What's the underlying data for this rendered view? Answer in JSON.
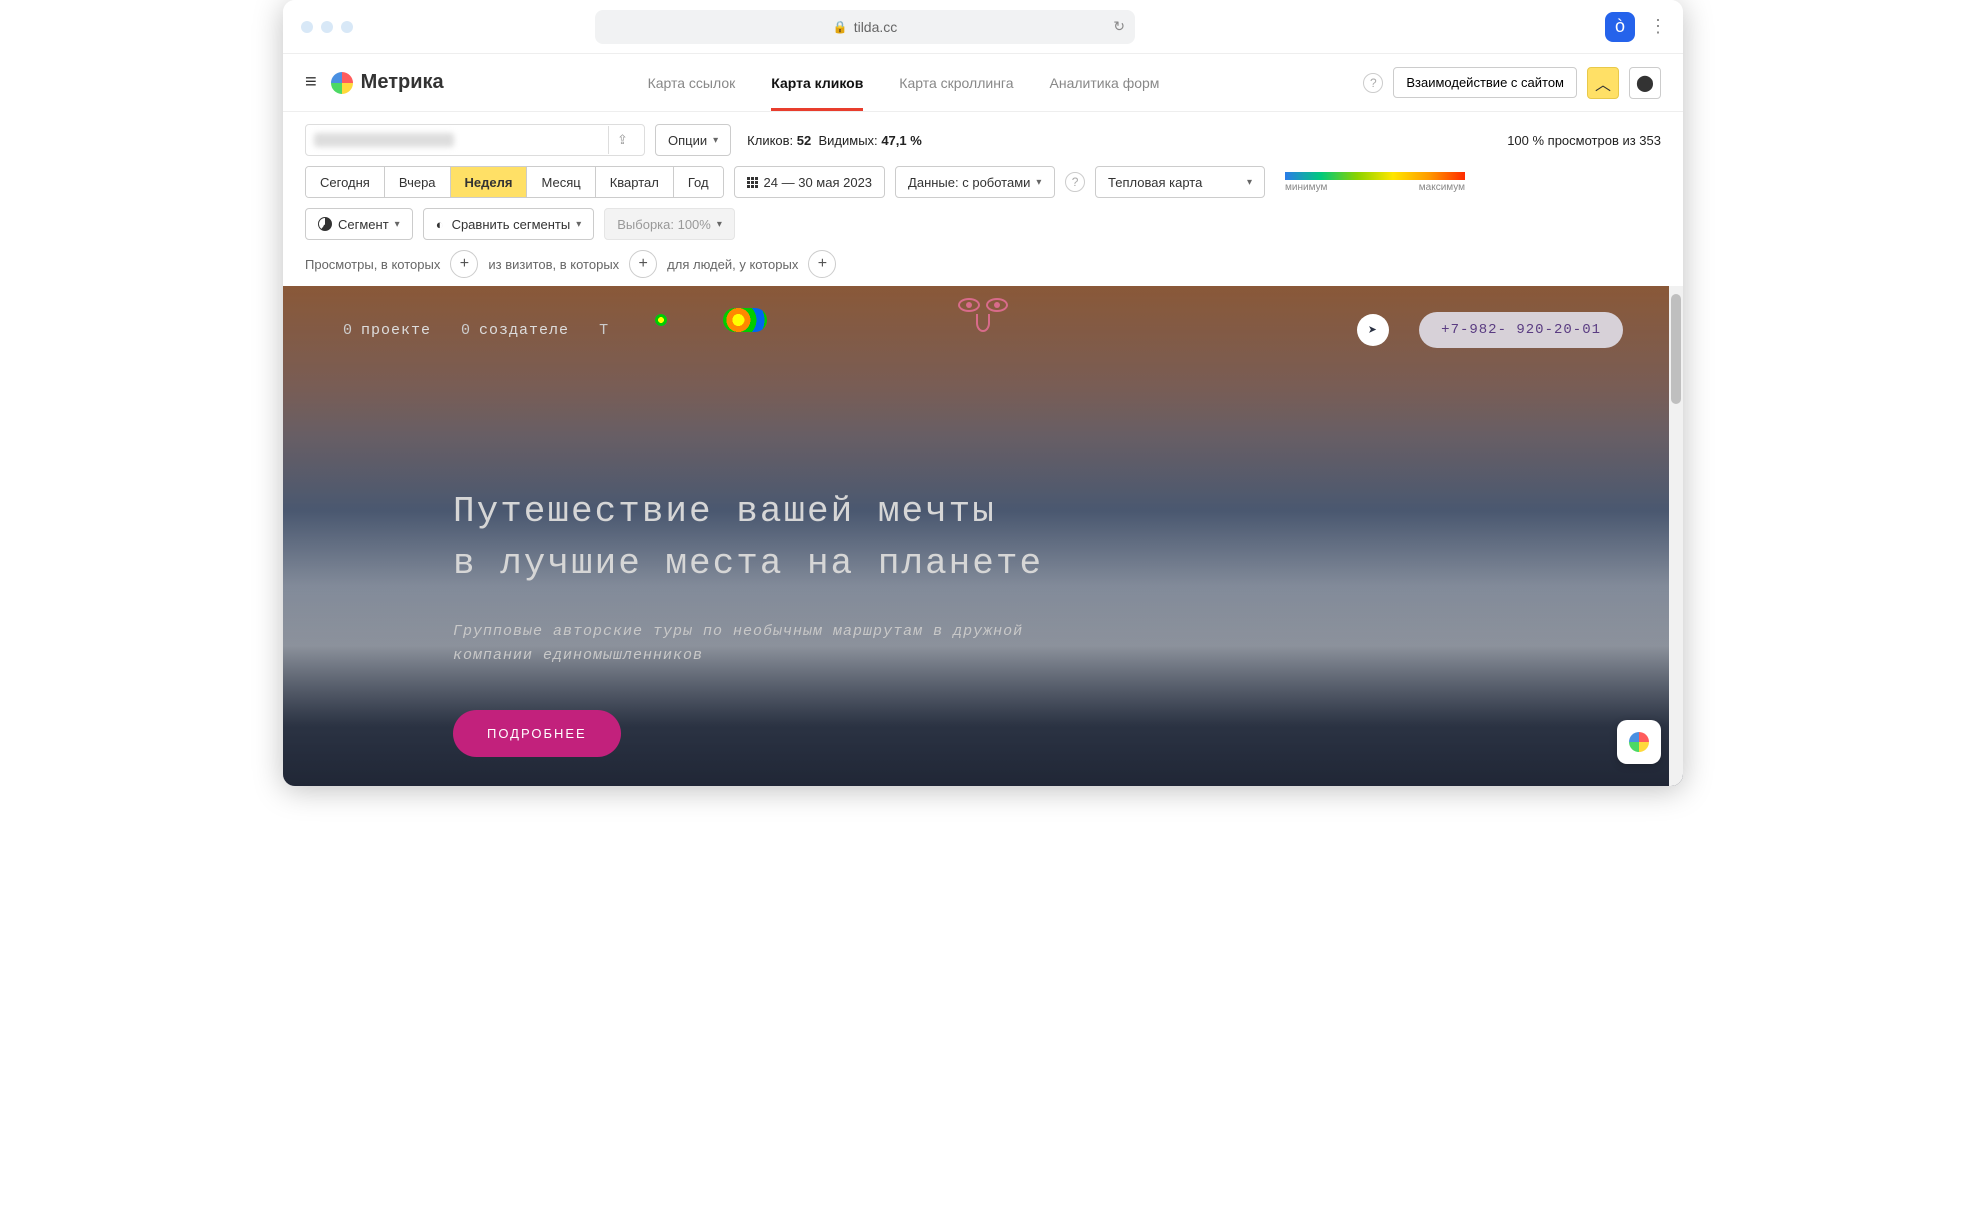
{
  "browser": {
    "url": "tilda.cc"
  },
  "app": {
    "name": "Метрика",
    "tabs": [
      "Карта ссылок",
      "Карта кликов",
      "Карта скроллинга",
      "Аналитика форм"
    ],
    "activeTab": 1,
    "interactBtn": "Взаимодействие с сайтом"
  },
  "toolbar": {
    "options": "Опции",
    "clicks_label": "Кликов:",
    "clicks_value": "52",
    "visible_label": "Видимых:",
    "visible_value": "47,1 %",
    "views_line": "100 % просмотров из 353",
    "periods": [
      "Сегодня",
      "Вчера",
      "Неделя",
      "Месяц",
      "Квартал",
      "Год"
    ],
    "activePeriod": 2,
    "date_range": "24 — 30 мая 2023",
    "data_select": "Данные: с роботами",
    "view_select": "Тепловая карта",
    "grad_min": "минимум",
    "grad_max": "максимум",
    "segment": "Сегмент",
    "compare": "Сравнить сегменты",
    "sample": "Выборка: 100%",
    "f_views": "Просмотры, в которых",
    "f_visits": "из визитов, в которых",
    "f_people": "для людей, у которых"
  },
  "site": {
    "nav": [
      {
        "idx": "0",
        "label": "проекте"
      },
      {
        "idx": "0",
        "label": "создателе"
      },
      {
        "idx": "Т",
        "label": ""
      }
    ],
    "phone": "+7-982- 920-20-01",
    "hero_l1": "Путешествие вашей мечты",
    "hero_l2": "в лучшие места на планете",
    "sub": "Групповые авторские туры по необычным маршрутам в дружной компании единомышленников",
    "cta": "ПОДРОБНЕЕ"
  }
}
